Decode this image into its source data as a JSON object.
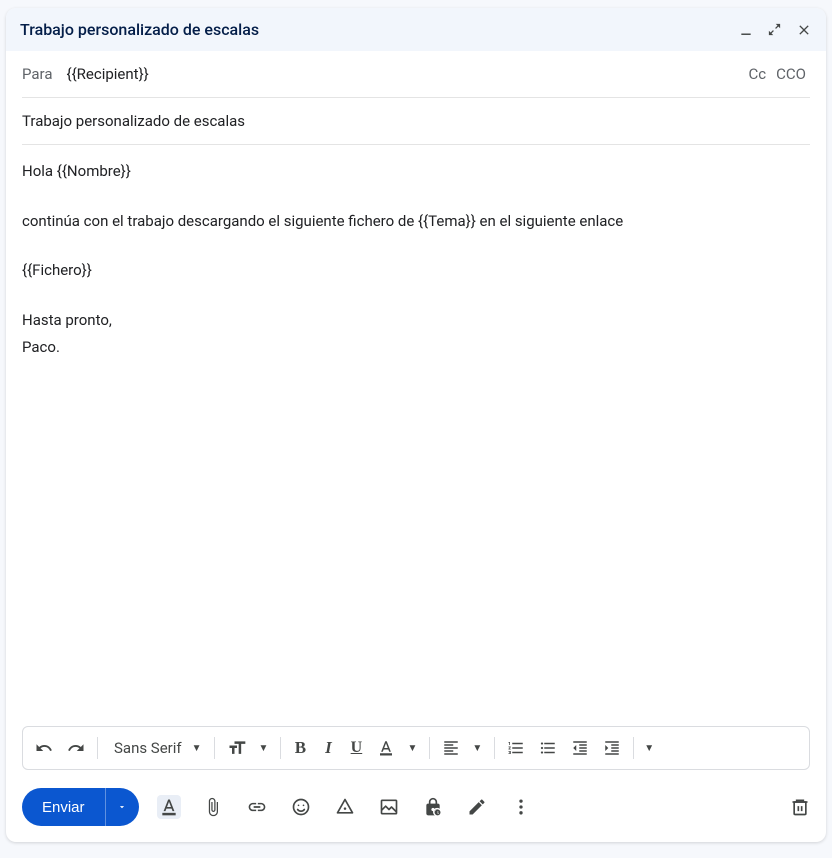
{
  "header": {
    "title": "Trabajo personalizado de escalas"
  },
  "to": {
    "label": "Para",
    "recipient": "{{Recipient}}",
    "cc": "Cc",
    "bcc": "CCO"
  },
  "subject": "Trabajo personalizado de escalas",
  "body": {
    "line1": "Hola {{Nombre}}",
    "line2": "continúa con el trabajo descargando el siguiente fichero de {{Tema}} en el siguiente enlace",
    "line3": "{{Fichero}}",
    "line4": "Hasta pronto,",
    "line5": "Paco."
  },
  "toolbar": {
    "font": "Sans Serif"
  },
  "actions": {
    "send": "Enviar"
  }
}
